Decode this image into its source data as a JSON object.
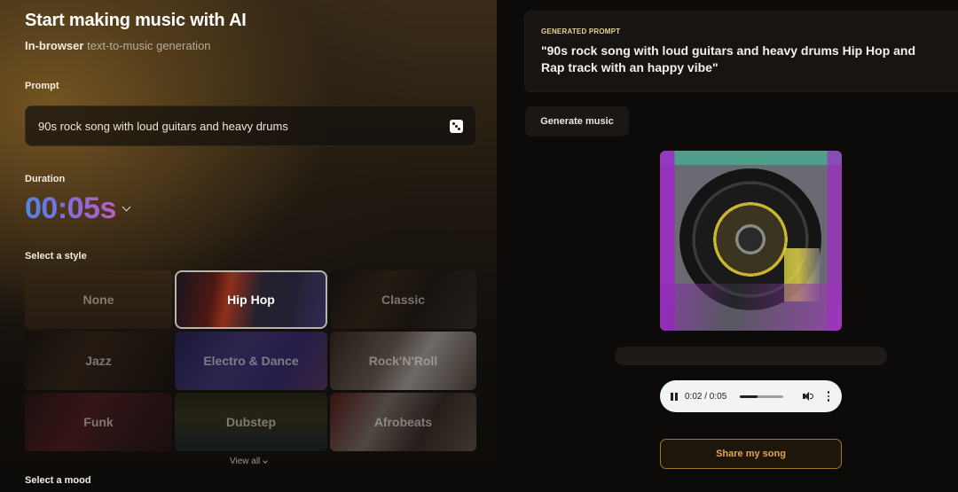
{
  "header": {
    "title": "Start making music with AI",
    "subtitle_bold": "In-browser",
    "subtitle_rest": " text-to-music generation"
  },
  "prompt": {
    "label": "Prompt",
    "value": "90s rock song with loud guitars and heavy drums",
    "randomize_icon": "dice-icon"
  },
  "duration": {
    "label": "Duration",
    "value": "00:05s"
  },
  "style": {
    "label": "Select a style",
    "selected": "Hip Hop",
    "options": [
      {
        "label": "None"
      },
      {
        "label": "Hip Hop"
      },
      {
        "label": "Classic"
      },
      {
        "label": "Jazz"
      },
      {
        "label": "Electro & Dance"
      },
      {
        "label": "Rock'N'Roll"
      },
      {
        "label": "Funk"
      },
      {
        "label": "Dubstep"
      },
      {
        "label": "Afrobeats"
      }
    ],
    "view_all_label": "View all"
  },
  "mood": {
    "label": "Select a mood"
  },
  "generated": {
    "label": "GENERATED PROMPT",
    "text": "\"90s rock song with loud guitars and heavy drums Hip Hop and Rap track with an happy vibe\""
  },
  "actions": {
    "generate_label": "Generate music",
    "share_label": "Share my song"
  },
  "player": {
    "time": "0:02 / 0:05",
    "progress_fraction": 0.4,
    "icons": [
      "pause-icon",
      "volume-icon",
      "more-options-icon"
    ]
  },
  "colors": {
    "accent_gold": "#e0a548",
    "generated_label": "#e2d39a",
    "duration_gradient_start": "#4f86ea",
    "duration_gradient_end": "#c05ac4"
  }
}
